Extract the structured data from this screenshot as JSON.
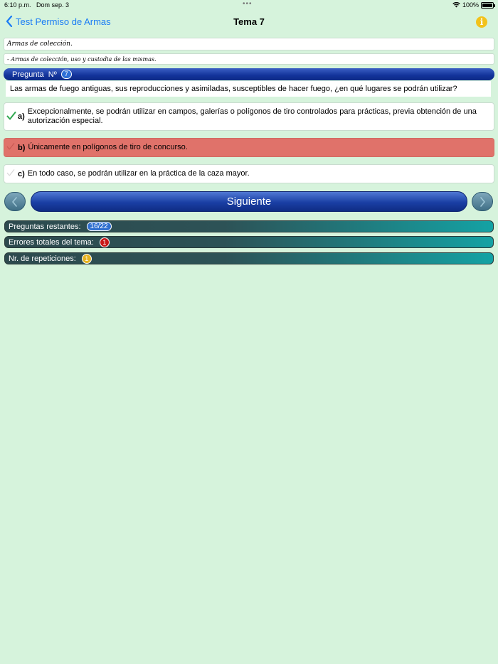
{
  "status_bar": {
    "time": "6:10 p.m.",
    "date": "Dom sep. 3",
    "battery": "100%",
    "icons": [
      "wifi-icon",
      "battery-icon"
    ]
  },
  "nav": {
    "back_label": "Test Permiso de Armas",
    "title": "Tema 7",
    "info_icon": "i"
  },
  "topic": {
    "line1": "Armas de colección.",
    "line2": "- Armas de colección, uso y custodia de las mismas."
  },
  "question": {
    "header_label": "Pregunta  Nº",
    "number": "7",
    "text": "Las armas de fuego antiguas, sus reproducciones y asimiladas, susceptibles de hacer fuego, ¿en qué lugares se podrán utilizar?"
  },
  "answers": [
    {
      "letter": "a)",
      "text": "Excepcionalmente, se podrán utilizar en campos, galerías o polígonos de tiro controlados para prácticas, previa obtención de una autorización especial.",
      "state": "correct"
    },
    {
      "letter": "b)",
      "text": "Únicamente en polígonos de tiro de concurso.",
      "state": "wrong"
    },
    {
      "letter": "c)",
      "text": "En todo caso, se podrán utilizar en la práctica de la caza mayor.",
      "state": "neutral"
    }
  ],
  "buttons": {
    "next_label": "Siguiente"
  },
  "stats": {
    "remaining_label": "Preguntas restantes:",
    "remaining_value": "16/22",
    "errors_label": "Errores totales del tema:",
    "errors_value": "1",
    "repeats_label": "Nr. de repeticiones:",
    "repeats_value": "1"
  },
  "colors": {
    "background": "#d6f3dc",
    "accent_blue": "#1a7cf5",
    "wrong_answer": "#e0726a",
    "correct_check": "#2fa84f"
  }
}
